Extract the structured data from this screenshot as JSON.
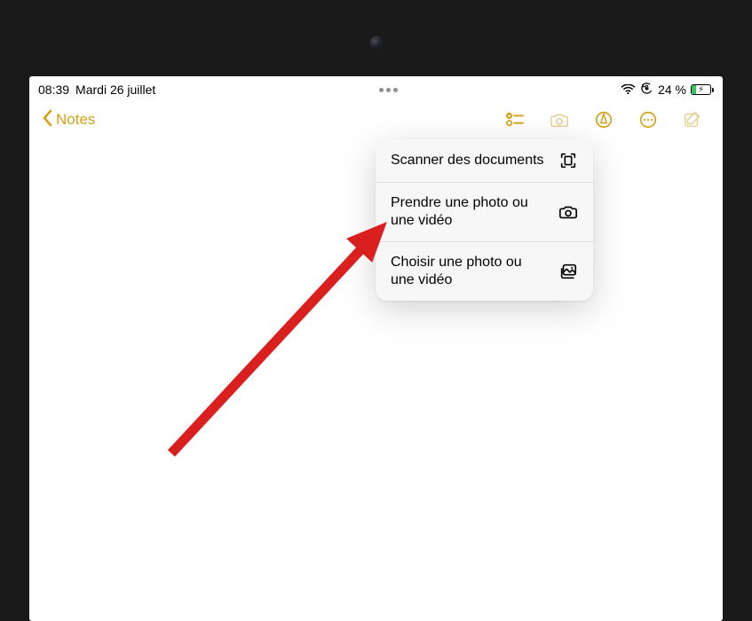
{
  "status": {
    "time": "08:39",
    "date": "Mardi 26 juillet",
    "battery_pct": "24 %"
  },
  "toolbar": {
    "back_label": "Notes"
  },
  "popover": {
    "items": [
      {
        "label": "Scanner des documents"
      },
      {
        "label": "Prendre une photo ou une vidéo"
      },
      {
        "label": "Choisir une photo ou une vidéo"
      }
    ]
  }
}
